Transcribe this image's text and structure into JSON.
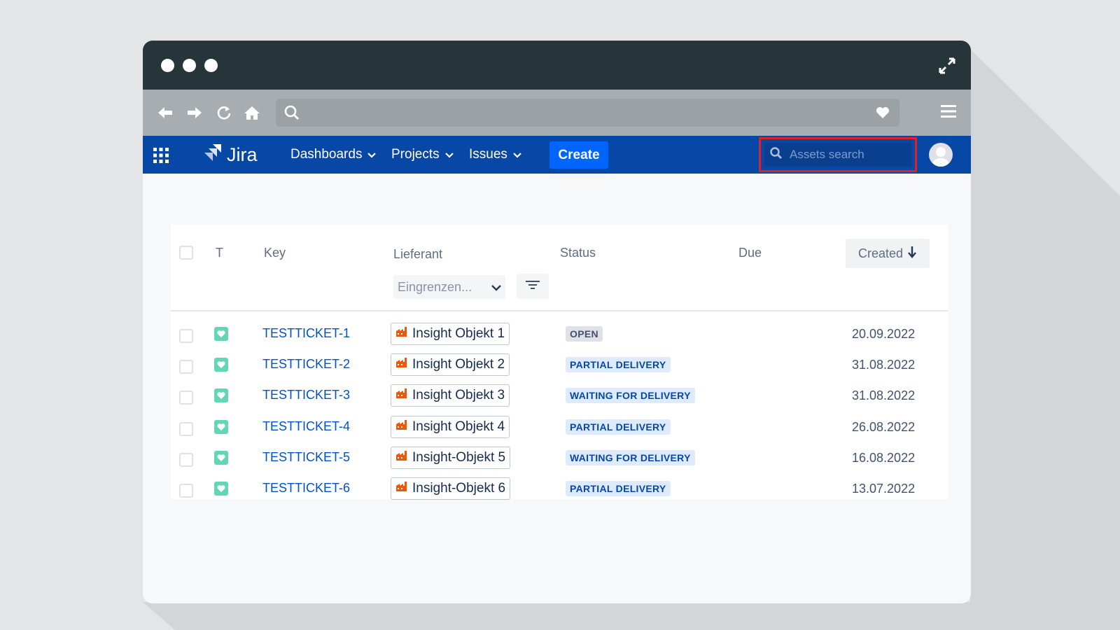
{
  "window": {
    "traffic_lights": 3
  },
  "browser": {
    "back_icon": "arrow-left-icon",
    "forward_icon": "arrow-right-icon",
    "reload_icon": "reload-icon",
    "home_icon": "home-icon",
    "search_icon": "search-icon",
    "bookmark_icon": "heart-icon",
    "menu_icon": "hamburger-menu-icon"
  },
  "jira": {
    "logo_text": "Jira",
    "nav": {
      "dashboards": "Dashboards",
      "projects": "Projects",
      "issues": "Issues"
    },
    "create_label": "Create",
    "assets_search_placeholder": "Assets search",
    "accent": "#0747a6",
    "highlight_color": "#e21f26"
  },
  "table": {
    "headers": {
      "t": "T",
      "key": "Key",
      "lieferant": "Lieferant",
      "status": "Status",
      "due": "Due",
      "created": "Created"
    },
    "filter_placeholder": "Eingrenzen...",
    "rows": [
      {
        "key": "TESTTICKET-1",
        "lieferant": "Insight Objekt 1",
        "status": "OPEN",
        "status_type": "open",
        "due": "",
        "created": "20.09.2022"
      },
      {
        "key": "TESTTICKET-2",
        "lieferant": "Insight Objekt 2",
        "status": "PARTIAL DELIVERY",
        "status_type": "blue",
        "due": "",
        "created": "31.08.2022"
      },
      {
        "key": "TESTTICKET-3",
        "lieferant": "Insight Objekt 3",
        "status": "WAITING FOR DELIVERY",
        "status_type": "blue",
        "due": "",
        "created": "31.08.2022"
      },
      {
        "key": "TESTTICKET-4",
        "lieferant": "Insight Objekt 4",
        "status": "PARTIAL DELIVERY",
        "status_type": "blue",
        "due": "",
        "created": "26.08.2022"
      },
      {
        "key": "TESTTICKET-5",
        "lieferant": "Insight-Objekt 5",
        "status": "WAITING FOR DELIVERY",
        "status_type": "blue",
        "due": "",
        "created": "16.08.2022"
      },
      {
        "key": "TESTTICKET-6",
        "lieferant": "Insight-Objekt 6",
        "status": "PARTIAL DELIVERY",
        "status_type": "blue",
        "due": "",
        "created": "13.07.2022"
      }
    ]
  }
}
